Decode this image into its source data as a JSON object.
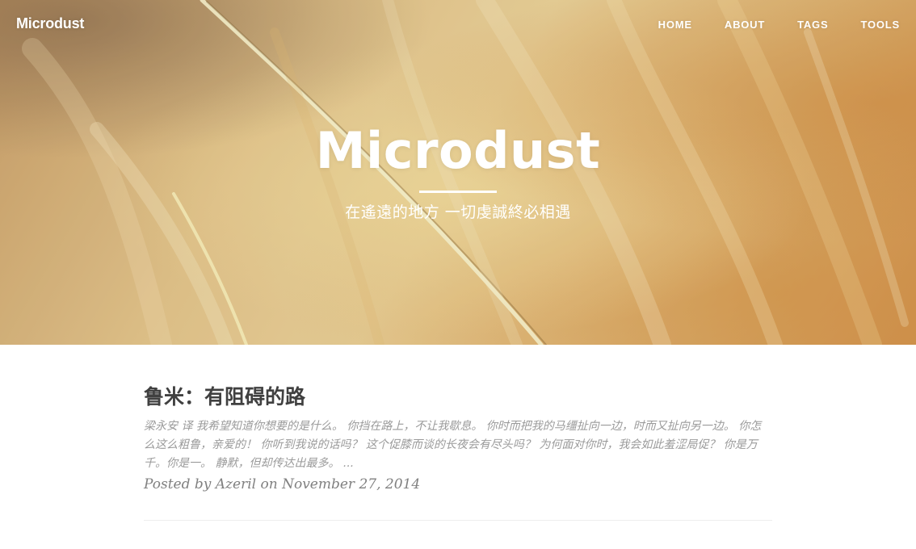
{
  "nav": {
    "brand": "Microdust",
    "links": [
      {
        "label": "HOME"
      },
      {
        "label": "ABOUT"
      },
      {
        "label": "TAGS"
      },
      {
        "label": "TOOLS"
      }
    ]
  },
  "hero": {
    "title": "Microdust",
    "subtitle": "在遙遠的地方 一切虔誠終必相遇"
  },
  "posts": [
    {
      "title": "鲁米：有阻碍的路",
      "excerpt": "梁永安 译 我希望知道你想要的是什么。 你挡在路上，不让我歇息。 你时而把我的马缰扯向一边，时而又扯向另一边。 你怎么这么粗鲁，亲爱的！ 你听到我说的话吗？ 这个促膝而谈的长夜会有尽头吗？ 为何面对你时，我会如此羞涩局促？ 你是万千。你是一。 静默，但却传达出最多。 ...",
      "meta_prefix": "Posted by",
      "author": "Azeril",
      "meta_on": "on",
      "date": "November 27, 2014"
    }
  ],
  "colors": {
    "title": "#404040",
    "excerpt": "#9a9a9a",
    "meta": "#808080"
  }
}
